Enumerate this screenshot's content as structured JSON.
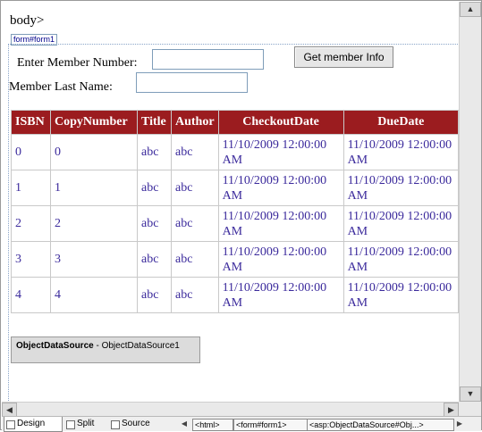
{
  "body_tag": "body>",
  "form_tag": "form#form1",
  "labels": {
    "member_number": "Enter Member Number:",
    "last_name": "Member Last Name:"
  },
  "inputs": {
    "member_number": "",
    "last_name": ""
  },
  "button": "Get member Info",
  "table": {
    "headers": [
      "ISBN",
      "CopyNumber",
      "Title",
      "Author",
      "CheckoutDate",
      "DueDate"
    ],
    "rows": [
      [
        "0",
        "0",
        "abc",
        "abc",
        "11/10/2009 12:00:00 AM",
        "11/10/2009 12:00:00 AM"
      ],
      [
        "1",
        "1",
        "abc",
        "abc",
        "11/10/2009 12:00:00 AM",
        "11/10/2009 12:00:00 AM"
      ],
      [
        "2",
        "2",
        "abc",
        "abc",
        "11/10/2009 12:00:00 AM",
        "11/10/2009 12:00:00 AM"
      ],
      [
        "3",
        "3",
        "abc",
        "abc",
        "11/10/2009 12:00:00 AM",
        "11/10/2009 12:00:00 AM"
      ],
      [
        "4",
        "4",
        "abc",
        "abc",
        "11/10/2009 12:00:00 AM",
        "11/10/2009 12:00:00 AM"
      ]
    ]
  },
  "object_data_source": {
    "type": "ObjectDataSource",
    "name": "ObjectDataSource1"
  },
  "status_bar": {
    "tabs": [
      "Design",
      "Split",
      "Source"
    ],
    "active_tab": "Design",
    "breadcrumbs": [
      "<html>",
      "<form#form1>",
      "<asp:ObjectDataSource#Obj...>"
    ]
  },
  "colors": {
    "header_bg": "#9b1c1f",
    "header_text": "#ffffff",
    "cell_text": "#3b2a9c"
  }
}
